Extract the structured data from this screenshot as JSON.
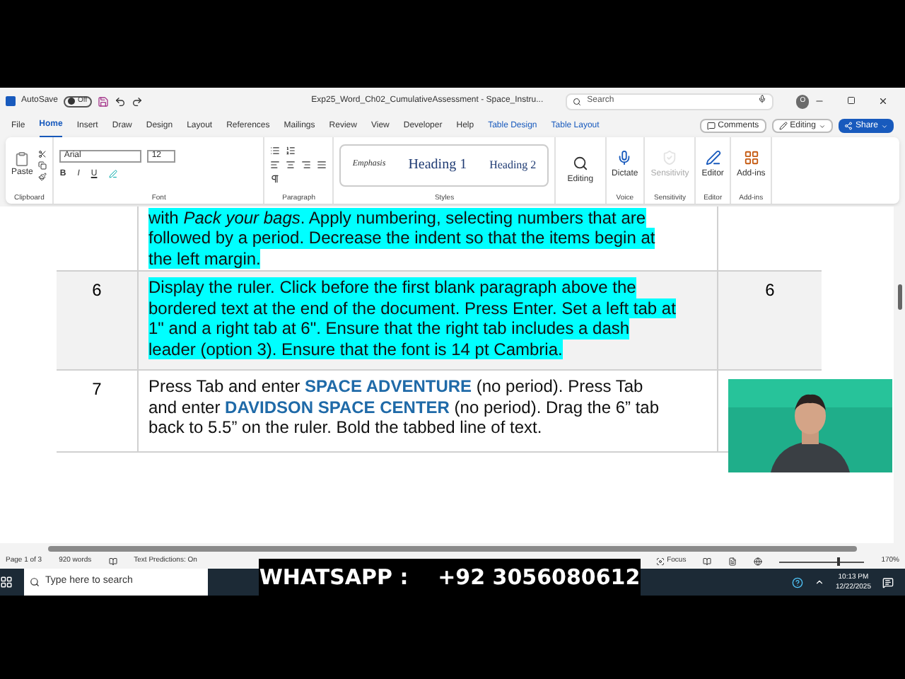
{
  "titlebar": {
    "autosave_label": "AutoSave",
    "autosave_state": "Off",
    "autosave_on": false,
    "document_title": "Exp25_Word_Ch02_CumulativeAssessment - Space_Instru...",
    "search_placeholder": "Search",
    "avatar": "O"
  },
  "menu_tabs": [
    {
      "label": "File",
      "selected": false
    },
    {
      "label": "Home",
      "selected": true
    },
    {
      "label": "Insert",
      "selected": false
    },
    {
      "label": "Draw",
      "selected": false
    },
    {
      "label": "Design",
      "selected": false
    },
    {
      "label": "Layout",
      "selected": false
    },
    {
      "label": "References",
      "selected": false
    },
    {
      "label": "Mailings",
      "selected": false
    },
    {
      "label": "Review",
      "selected": false
    },
    {
      "label": "View",
      "selected": false
    },
    {
      "label": "Developer",
      "selected": false
    },
    {
      "label": "Help",
      "selected": false
    },
    {
      "label": "Table Design",
      "selected": false
    },
    {
      "label": "Table Layout",
      "selected": false
    }
  ],
  "top_buttons": {
    "comments": "Comments",
    "editing": "Editing",
    "share": "Share"
  },
  "ribbon": {
    "paste": "Paste",
    "font_name": "Arial",
    "font_size": "12",
    "bold": "B",
    "italic": "I",
    "underline": "U",
    "styles": [
      "Emphasis",
      "Heading 1",
      "Heading 2"
    ],
    "big_buttons": [
      {
        "label": "Editing",
        "disabled": false
      },
      {
        "label": "Dictate",
        "disabled": false
      },
      {
        "label": "Sensitivity",
        "disabled": true
      },
      {
        "label": "Editor",
        "disabled": false
      },
      {
        "label": "Add-ins",
        "disabled": false
      }
    ],
    "groups": [
      "Clipboard",
      "Font",
      "Paragraph",
      "Styles",
      "Voice",
      "Sensitivity",
      "Editor",
      "Add-ins"
    ]
  },
  "table": {
    "rows": [
      {
        "number": "",
        "text": [
          "with *Pack your bags*. Apply numbering, selecting numbers that are",
          "followed by a period. Decrease the indent so that the items begin at",
          "the left margin."
        ],
        "highlighted": true,
        "points": ""
      },
      {
        "number": "6",
        "text": [
          "Display the ruler. Click before the first blank paragraph above the",
          "bordered text at the end of the document. Press Enter. Set a left tab at",
          "1\" and a right tab at 6\". Ensure that the right tab includes a dash",
          "leader (option 3). Ensure that the font is 14 pt Cambria."
        ],
        "highlighted": true,
        "points": "6"
      },
      {
        "number": "7",
        "text": [
          "Press Tab and enter **SPACE ADVENTURE** (no period). Press Tab",
          "and enter **DAVIDSON SPACE CENTER** (no period). Drag the 6” tab",
          "back to 5.5” on the ruler. Bold the tabbed line of text."
        ],
        "highlighted": false,
        "points": ""
      }
    ]
  },
  "status_bar": {
    "page": "Page 1 of 3",
    "words": "920 words",
    "predictions": "Text Predictions: On",
    "focus": "Focus",
    "zoom_slider": {
      "level": 0.7
    },
    "zoom": "170%"
  },
  "taskbar": {
    "search_placeholder": "Type here to search",
    "time": "10:13 PM",
    "date": "12/22/2025"
  },
  "banner": "WHATSAPP :    +92 3056080612"
}
